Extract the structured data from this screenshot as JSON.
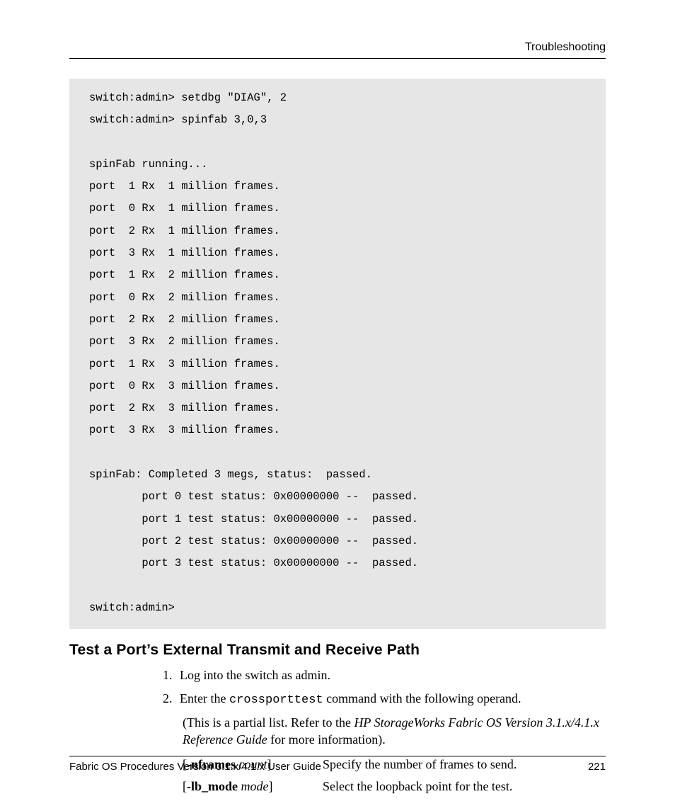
{
  "header": {
    "section": "Troubleshooting"
  },
  "code": {
    "lines": [
      "switch:admin> setdbg \"DIAG\", 2",
      "switch:admin> spinfab 3,0,3",
      "",
      "spinFab running...",
      "port  1 Rx  1 million frames.",
      "port  0 Rx  1 million frames.",
      "port  2 Rx  1 million frames.",
      "port  3 Rx  1 million frames.",
      "port  1 Rx  2 million frames.",
      "port  0 Rx  2 million frames.",
      "port  2 Rx  2 million frames.",
      "port  3 Rx  2 million frames.",
      "port  1 Rx  3 million frames.",
      "port  0 Rx  3 million frames.",
      "port  2 Rx  3 million frames.",
      "port  3 Rx  3 million frames.",
      "",
      "spinFab: Completed 3 megs, status:  passed.",
      "        port 0 test status: 0x00000000 --  passed.",
      "        port 1 test status: 0x00000000 --  passed.",
      "        port 2 test status: 0x00000000 --  passed.",
      "        port 3 test status: 0x00000000 --  passed.",
      "",
      "switch:admin>"
    ]
  },
  "section_heading": "Test a Port’s External Transmit and Receive Path",
  "steps": {
    "s1": "Log into the switch as admin.",
    "s2_a": "Enter the ",
    "s2_cmd": "crossporttest",
    "s2_b": " command with the following operand."
  },
  "note": {
    "a": "(This is a partial list. Refer to the ",
    "ref": "HP StorageWorks Fabric OS Version 3.1.x/4.1.x Reference Guide",
    "b": " for more information)."
  },
  "options": {
    "r0": {
      "bracket_open": "[",
      "flag": "-nframes",
      "space": " ",
      "arg": "count",
      "bracket_close": "]",
      "desc": "Specify the number of frames to send."
    },
    "r1": {
      "bracket_open": "[",
      "flag": "-lb_mode",
      "space": " ",
      "arg": "mode",
      "bracket_close": "]",
      "desc": "Select the loopback point for the test."
    }
  },
  "footer": {
    "left": "Fabric OS Procedures Version 3.1.x/4.1.x User Guide",
    "right": "221"
  }
}
